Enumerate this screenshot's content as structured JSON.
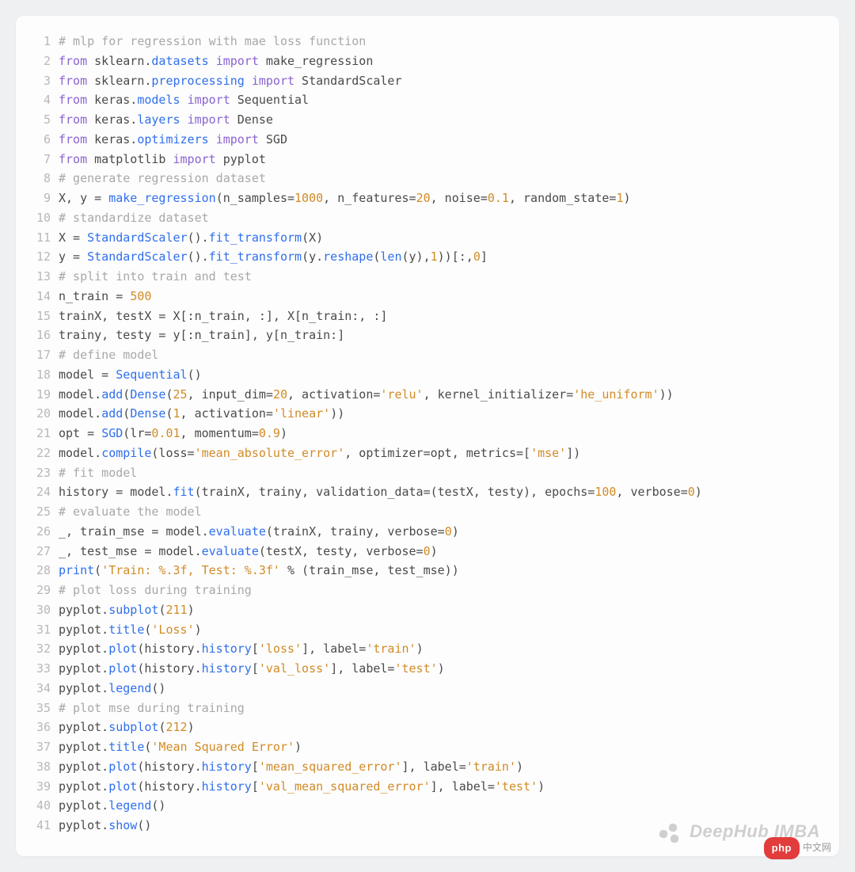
{
  "watermark": {
    "text": "DeepHub IMBA"
  },
  "php_badge": {
    "pill": "php",
    "suffix": "中文网"
  },
  "code": {
    "lines": [
      {
        "n": 1,
        "tokens": [
          [
            "cm",
            "# mlp for regression with mae loss function"
          ]
        ]
      },
      {
        "n": 2,
        "tokens": [
          [
            "kw",
            "from"
          ],
          [
            "id",
            " sklearn."
          ],
          [
            "fn",
            "datasets"
          ],
          [
            "id",
            " "
          ],
          [
            "kw",
            "import"
          ],
          [
            "id",
            " make_regression"
          ]
        ]
      },
      {
        "n": 3,
        "tokens": [
          [
            "kw",
            "from"
          ],
          [
            "id",
            " sklearn."
          ],
          [
            "fn",
            "preprocessing"
          ],
          [
            "id",
            " "
          ],
          [
            "kw",
            "import"
          ],
          [
            "id",
            " StandardScaler"
          ]
        ]
      },
      {
        "n": 4,
        "tokens": [
          [
            "kw",
            "from"
          ],
          [
            "id",
            " keras."
          ],
          [
            "fn",
            "models"
          ],
          [
            "id",
            " "
          ],
          [
            "kw",
            "import"
          ],
          [
            "id",
            " Sequential"
          ]
        ]
      },
      {
        "n": 5,
        "tokens": [
          [
            "kw",
            "from"
          ],
          [
            "id",
            " keras."
          ],
          [
            "fn",
            "layers"
          ],
          [
            "id",
            " "
          ],
          [
            "kw",
            "import"
          ],
          [
            "id",
            " Dense"
          ]
        ]
      },
      {
        "n": 6,
        "tokens": [
          [
            "kw",
            "from"
          ],
          [
            "id",
            " keras."
          ],
          [
            "fn",
            "optimizers"
          ],
          [
            "id",
            " "
          ],
          [
            "kw",
            "import"
          ],
          [
            "id",
            " SGD"
          ]
        ]
      },
      {
        "n": 7,
        "tokens": [
          [
            "kw",
            "from"
          ],
          [
            "id",
            " matplotlib "
          ],
          [
            "kw",
            "import"
          ],
          [
            "id",
            " pyplot"
          ]
        ]
      },
      {
        "n": 8,
        "tokens": [
          [
            "cm",
            "# generate regression dataset"
          ]
        ]
      },
      {
        "n": 9,
        "tokens": [
          [
            "id",
            "X, y = "
          ],
          [
            "fn",
            "make_regression"
          ],
          [
            "id",
            "(n_samples="
          ],
          [
            "nm",
            "1000"
          ],
          [
            "id",
            ", n_features="
          ],
          [
            "nm",
            "20"
          ],
          [
            "id",
            ", noise="
          ],
          [
            "nm",
            "0.1"
          ],
          [
            "id",
            ", random_state="
          ],
          [
            "nm",
            "1"
          ],
          [
            "id",
            ")"
          ]
        ]
      },
      {
        "n": 10,
        "tokens": [
          [
            "cm",
            "# standardize dataset"
          ]
        ]
      },
      {
        "n": 11,
        "tokens": [
          [
            "id",
            "X = "
          ],
          [
            "fn",
            "StandardScaler"
          ],
          [
            "id",
            "()."
          ],
          [
            "fn",
            "fit_transform"
          ],
          [
            "id",
            "(X)"
          ]
        ]
      },
      {
        "n": 12,
        "tokens": [
          [
            "id",
            "y = "
          ],
          [
            "fn",
            "StandardScaler"
          ],
          [
            "id",
            "()."
          ],
          [
            "fn",
            "fit_transform"
          ],
          [
            "id",
            "(y."
          ],
          [
            "fn",
            "reshape"
          ],
          [
            "id",
            "("
          ],
          [
            "fn",
            "len"
          ],
          [
            "id",
            "(y),"
          ],
          [
            "nm",
            "1"
          ],
          [
            "id",
            "))[:,"
          ],
          [
            "nm",
            "0"
          ],
          [
            "id",
            "]"
          ]
        ]
      },
      {
        "n": 13,
        "tokens": [
          [
            "cm",
            "# split into train and test"
          ]
        ]
      },
      {
        "n": 14,
        "tokens": [
          [
            "id",
            "n_train = "
          ],
          [
            "nm",
            "500"
          ]
        ]
      },
      {
        "n": 15,
        "tokens": [
          [
            "id",
            "trainX, testX = X[:n_train, :], X[n_train:, :]"
          ]
        ]
      },
      {
        "n": 16,
        "tokens": [
          [
            "id",
            "trainy, testy = y[:n_train], y[n_train:]"
          ]
        ]
      },
      {
        "n": 17,
        "tokens": [
          [
            "cm",
            "# define model"
          ]
        ]
      },
      {
        "n": 18,
        "tokens": [
          [
            "id",
            "model = "
          ],
          [
            "fn",
            "Sequential"
          ],
          [
            "id",
            "()"
          ]
        ]
      },
      {
        "n": 19,
        "tokens": [
          [
            "id",
            "model."
          ],
          [
            "fn",
            "add"
          ],
          [
            "id",
            "("
          ],
          [
            "fn",
            "Dense"
          ],
          [
            "id",
            "("
          ],
          [
            "nm",
            "25"
          ],
          [
            "id",
            ", input_dim="
          ],
          [
            "nm",
            "20"
          ],
          [
            "id",
            ", activation="
          ],
          [
            "st",
            "'relu'"
          ],
          [
            "id",
            ", kernel_initializer="
          ],
          [
            "st",
            "'he_uniform'"
          ],
          [
            "id",
            "))"
          ]
        ]
      },
      {
        "n": 20,
        "tokens": [
          [
            "id",
            "model."
          ],
          [
            "fn",
            "add"
          ],
          [
            "id",
            "("
          ],
          [
            "fn",
            "Dense"
          ],
          [
            "id",
            "("
          ],
          [
            "nm",
            "1"
          ],
          [
            "id",
            ", activation="
          ],
          [
            "st",
            "'linear'"
          ],
          [
            "id",
            "))"
          ]
        ]
      },
      {
        "n": 21,
        "tokens": [
          [
            "id",
            "opt = "
          ],
          [
            "fn",
            "SGD"
          ],
          [
            "id",
            "(lr="
          ],
          [
            "nm",
            "0.01"
          ],
          [
            "id",
            ", momentum="
          ],
          [
            "nm",
            "0.9"
          ],
          [
            "id",
            ")"
          ]
        ]
      },
      {
        "n": 22,
        "tokens": [
          [
            "id",
            "model."
          ],
          [
            "fn",
            "compile"
          ],
          [
            "id",
            "(loss="
          ],
          [
            "st",
            "'mean_absolute_error'"
          ],
          [
            "id",
            ", optimizer=opt, metrics=["
          ],
          [
            "st",
            "'mse'"
          ],
          [
            "id",
            "])"
          ]
        ]
      },
      {
        "n": 23,
        "tokens": [
          [
            "cm",
            "# fit model"
          ]
        ]
      },
      {
        "n": 24,
        "tokens": [
          [
            "id",
            "history = model."
          ],
          [
            "fn",
            "fit"
          ],
          [
            "id",
            "(trainX, trainy, validation_data=(testX, testy), epochs="
          ],
          [
            "nm",
            "100"
          ],
          [
            "id",
            ", verbose="
          ],
          [
            "nm",
            "0"
          ],
          [
            "id",
            ")"
          ]
        ]
      },
      {
        "n": 25,
        "tokens": [
          [
            "cm",
            "# evaluate the model"
          ]
        ]
      },
      {
        "n": 26,
        "tokens": [
          [
            "id",
            "_, train_mse = model."
          ],
          [
            "fn",
            "evaluate"
          ],
          [
            "id",
            "(trainX, trainy, verbose="
          ],
          [
            "nm",
            "0"
          ],
          [
            "id",
            ")"
          ]
        ]
      },
      {
        "n": 27,
        "tokens": [
          [
            "id",
            "_, test_mse = model."
          ],
          [
            "fn",
            "evaluate"
          ],
          [
            "id",
            "(testX, testy, verbose="
          ],
          [
            "nm",
            "0"
          ],
          [
            "id",
            ")"
          ]
        ]
      },
      {
        "n": 28,
        "tokens": [
          [
            "fn",
            "print"
          ],
          [
            "id",
            "("
          ],
          [
            "st",
            "'Train: %.3f, Test: %.3f'"
          ],
          [
            "id",
            " % (train_mse, test_mse))"
          ]
        ]
      },
      {
        "n": 29,
        "tokens": [
          [
            "cm",
            "# plot loss during training"
          ]
        ]
      },
      {
        "n": 30,
        "tokens": [
          [
            "id",
            "pyplot."
          ],
          [
            "fn",
            "subplot"
          ],
          [
            "id",
            "("
          ],
          [
            "nm",
            "211"
          ],
          [
            "id",
            ")"
          ]
        ]
      },
      {
        "n": 31,
        "tokens": [
          [
            "id",
            "pyplot."
          ],
          [
            "fn",
            "title"
          ],
          [
            "id",
            "("
          ],
          [
            "st",
            "'Loss'"
          ],
          [
            "id",
            ")"
          ]
        ]
      },
      {
        "n": 32,
        "tokens": [
          [
            "id",
            "pyplot."
          ],
          [
            "fn",
            "plot"
          ],
          [
            "id",
            "(history."
          ],
          [
            "fn",
            "history"
          ],
          [
            "id",
            "["
          ],
          [
            "st",
            "'loss'"
          ],
          [
            "id",
            "], label="
          ],
          [
            "st",
            "'train'"
          ],
          [
            "id",
            ")"
          ]
        ]
      },
      {
        "n": 33,
        "tokens": [
          [
            "id",
            "pyplot."
          ],
          [
            "fn",
            "plot"
          ],
          [
            "id",
            "(history."
          ],
          [
            "fn",
            "history"
          ],
          [
            "id",
            "["
          ],
          [
            "st",
            "'val_loss'"
          ],
          [
            "id",
            "], label="
          ],
          [
            "st",
            "'test'"
          ],
          [
            "id",
            ")"
          ]
        ]
      },
      {
        "n": 34,
        "tokens": [
          [
            "id",
            "pyplot."
          ],
          [
            "fn",
            "legend"
          ],
          [
            "id",
            "()"
          ]
        ]
      },
      {
        "n": 35,
        "tokens": [
          [
            "cm",
            "# plot mse during training"
          ]
        ]
      },
      {
        "n": 36,
        "tokens": [
          [
            "id",
            "pyplot."
          ],
          [
            "fn",
            "subplot"
          ],
          [
            "id",
            "("
          ],
          [
            "nm",
            "212"
          ],
          [
            "id",
            ")"
          ]
        ]
      },
      {
        "n": 37,
        "tokens": [
          [
            "id",
            "pyplot."
          ],
          [
            "fn",
            "title"
          ],
          [
            "id",
            "("
          ],
          [
            "st",
            "'Mean Squared Error'"
          ],
          [
            "id",
            ")"
          ]
        ]
      },
      {
        "n": 38,
        "tokens": [
          [
            "id",
            "pyplot."
          ],
          [
            "fn",
            "plot"
          ],
          [
            "id",
            "(history."
          ],
          [
            "fn",
            "history"
          ],
          [
            "id",
            "["
          ],
          [
            "st",
            "'mean_squared_error'"
          ],
          [
            "id",
            "], label="
          ],
          [
            "st",
            "'train'"
          ],
          [
            "id",
            ")"
          ]
        ]
      },
      {
        "n": 39,
        "tokens": [
          [
            "id",
            "pyplot."
          ],
          [
            "fn",
            "plot"
          ],
          [
            "id",
            "(history."
          ],
          [
            "fn",
            "history"
          ],
          [
            "id",
            "["
          ],
          [
            "st",
            "'val_mean_squared_error'"
          ],
          [
            "id",
            "], label="
          ],
          [
            "st",
            "'test'"
          ],
          [
            "id",
            ")"
          ]
        ]
      },
      {
        "n": 40,
        "tokens": [
          [
            "id",
            "pyplot."
          ],
          [
            "fn",
            "legend"
          ],
          [
            "id",
            "()"
          ]
        ]
      },
      {
        "n": 41,
        "tokens": [
          [
            "id",
            "pyplot."
          ],
          [
            "fn",
            "show"
          ],
          [
            "id",
            "()"
          ]
        ]
      }
    ]
  }
}
